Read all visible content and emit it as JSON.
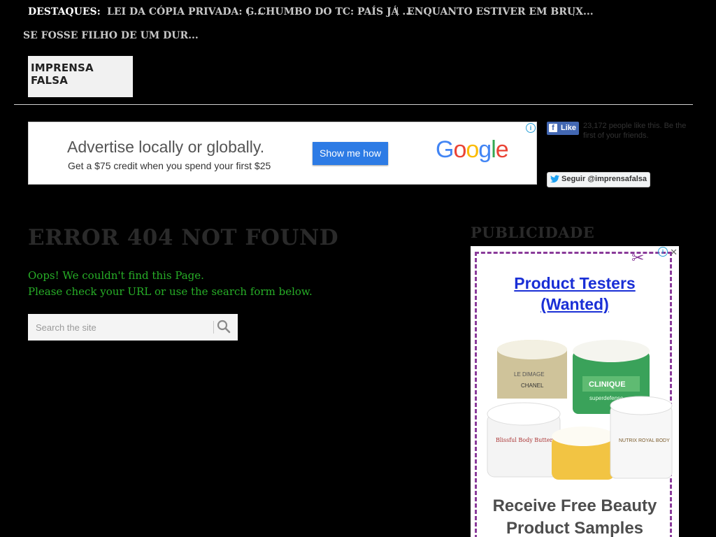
{
  "ticker": {
    "label": "DESTAQUES:",
    "items": [
      "LEI DA CÓPIA PRIVADA: G...",
      "CHUMBO DO TC: PAÍS JÁ ...",
      "ENQUANTO ESTIVER EM BRUX...",
      "SE FOSSE FILHO DE UM DUR..."
    ]
  },
  "logo": {
    "text": "IMPRENSA FALSA"
  },
  "google_ad": {
    "headline": "Advertise locally or globally.",
    "subline": "Get a $75 credit when you spend your first $25",
    "button": "Show me how",
    "brand": "Google",
    "info_glyph": "i"
  },
  "social": {
    "fb_like_label": "Like",
    "fb_count_text": "23,172 people like this. Be the first of your friends.",
    "twitter_follow_label": "Seguir @imprensafalsa"
  },
  "main": {
    "title": "ERROR 404 NOT FOUND",
    "line1": "Oops! We couldn't find this Page.",
    "line2": "Please check your URL or use the search form below.",
    "search_placeholder": "Search the site"
  },
  "sidebar": {
    "title": "PUBLICIDADE",
    "ad_headline_1": "Product Testers",
    "ad_headline_2": "(Wanted)",
    "ad_footer_1": "Receive Free Beauty",
    "ad_footer_2": "Product Samples",
    "jar_labels": [
      "LE DIMAGE",
      "CHANEL",
      "CLINIQUE",
      "superdefense",
      "Blissful Body Butter",
      "NUTRIX ROYAL BODY"
    ],
    "close_glyph": "✕"
  },
  "colors": {
    "background": "#000000",
    "accent_green": "#27ae27",
    "ad_blue": "#1a2fd6",
    "coupon_purple": "#8a3b9a"
  }
}
